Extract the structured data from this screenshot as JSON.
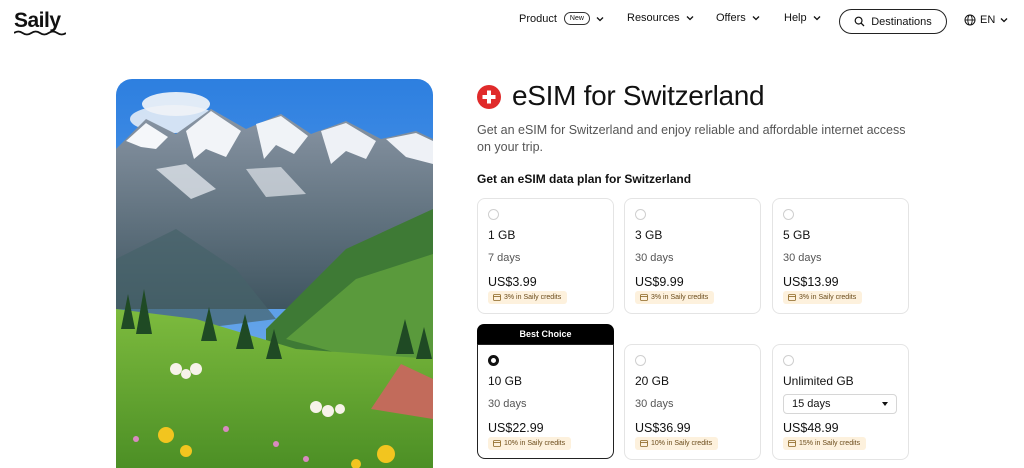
{
  "header": {
    "logo": "Saily",
    "nav": [
      {
        "label": "Product",
        "badge": "New"
      },
      {
        "label": "Resources"
      },
      {
        "label": "Offers"
      },
      {
        "label": "Help"
      }
    ],
    "destinations_label": "Destinations",
    "language": "EN"
  },
  "main": {
    "title": "eSIM for Switzerland",
    "description": "Get an eSIM for Switzerland and enjoy reliable and affordable internet access on your trip.",
    "subheading": "Get an eSIM data plan for Switzerland",
    "best_choice_label": "Best Choice",
    "plans": [
      {
        "data": "1 GB",
        "days": "7 days",
        "price": "US$3.99",
        "credits": "3% in Saily credits",
        "selected": false
      },
      {
        "data": "3 GB",
        "days": "30 days",
        "price": "US$9.99",
        "credits": "3% in Saily credits",
        "selected": false
      },
      {
        "data": "5 GB",
        "days": "30 days",
        "price": "US$13.99",
        "credits": "3% in Saily credits",
        "selected": false
      },
      {
        "data": "10 GB",
        "days": "30 days",
        "price": "US$22.99",
        "credits": "10% in Saily credits",
        "selected": true
      },
      {
        "data": "20 GB",
        "days": "30 days",
        "price": "US$36.99",
        "credits": "10% in Saily credits",
        "selected": false
      },
      {
        "data": "Unlimited GB",
        "days": "15 days",
        "price": "US$48.99",
        "credits": "15% in Saily credits",
        "selected": false
      }
    ]
  },
  "colors": {
    "flag_red": "#e02b2b",
    "credits_bg": "#fdf1dd",
    "best_choice_bg": "#000000"
  },
  "icons": [
    "chevron-down-icon",
    "search-icon",
    "globe-icon",
    "swiss-flag-icon",
    "credits-card-icon"
  ]
}
